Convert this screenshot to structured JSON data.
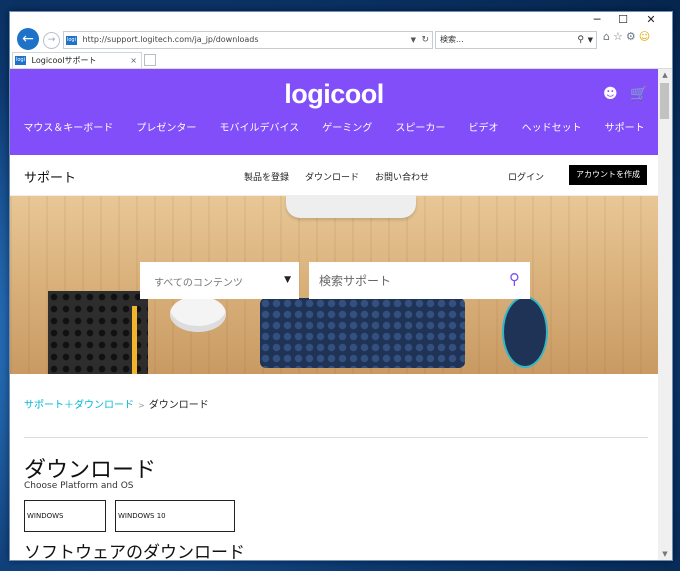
{
  "browser": {
    "url": "http://support.logitech.com/ja_jp/downloads",
    "search_placeholder": "検索...",
    "tab_title": "Logicoolサポート",
    "favicon_text": "logi",
    "window_controls": [
      "─",
      "☐",
      "✕"
    ]
  },
  "site": {
    "logo": "logicool",
    "nav": [
      "マウス＆キーボード",
      "プレゼンター",
      "モバイルデバイス",
      "ゲーミング",
      "スピーカー",
      "ビデオ",
      "ヘッドセット",
      "サポート"
    ],
    "brand_color": "#814efa"
  },
  "subbar": {
    "title": "サポート",
    "links": [
      "製品を登録",
      "ダウンロード",
      "お問い合わせ"
    ],
    "login": "ログイン",
    "create_account": "アカウントを作成"
  },
  "hero": {
    "category_select": "すべてのコンテンツ",
    "search_placeholder": "検索サポート"
  },
  "breadcrumb": {
    "link": "サポート＋ダウンロード",
    "separator": ">",
    "current": "ダウンロード"
  },
  "main": {
    "heading": "ダウンロード",
    "subheading": "Choose Platform and OS",
    "os_buttons": [
      "WINDOWS",
      "WINDOWS 10"
    ],
    "next_heading": "ソフトウェアのダウンロード"
  }
}
